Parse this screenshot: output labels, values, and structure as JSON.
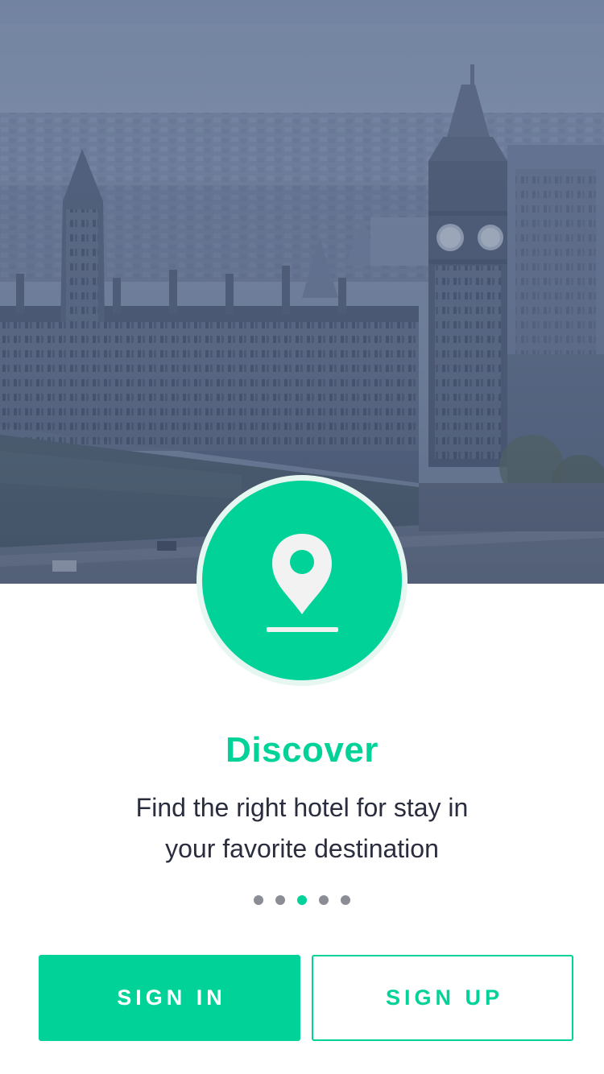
{
  "hero": {
    "image": "city-skyline-big-ben-photo",
    "overlay_color": "#5a6f95"
  },
  "badge": {
    "icon": "location-pin-icon",
    "color": "#00d298"
  },
  "onboarding": {
    "title": "Discover",
    "subtitle_line1": "Find the right hotel for stay in",
    "subtitle_line2": "your favorite destination"
  },
  "pager": {
    "total": 5,
    "active_index": 2
  },
  "actions": {
    "sign_in_label": "SIGN IN",
    "sign_up_label": "SIGN UP"
  },
  "colors": {
    "accent": "#00d298",
    "text_dark": "#2a2d3e",
    "dot_inactive": "#8b8d95"
  }
}
